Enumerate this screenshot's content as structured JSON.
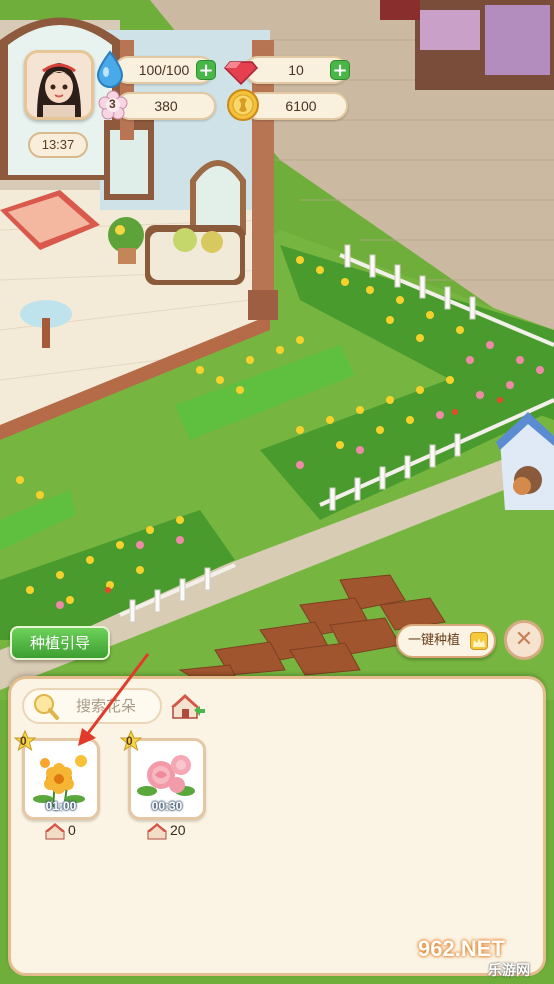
{
  "hud": {
    "time": "13:37",
    "water": "100/100",
    "gems": "10",
    "level": "3",
    "flowers": "380",
    "coins": "6100"
  },
  "buttons": {
    "guide": "种植引导",
    "plant_all": "一键种植"
  },
  "panel": {
    "search_placeholder": "搜索花朵",
    "seeds": [
      {
        "name": "marigold",
        "level": "0",
        "timer": "01:00",
        "cost": "0"
      },
      {
        "name": "rose",
        "level": "0",
        "timer": "00:30",
        "cost": "20"
      }
    ]
  },
  "watermark": {
    "brand": "962.NET",
    "sub": "乐游网"
  },
  "icons": [
    "water-drop-icon",
    "gem-icon",
    "flower-level-icon",
    "coin-icon",
    "plus-icon",
    "search-icon",
    "house-icon",
    "crown-icon",
    "close-icon",
    "star-icon"
  ],
  "colors": {
    "grass": "#6fae3b",
    "panel_bg": "#fbf3e3",
    "panel_border": "#e4bd8f",
    "accent_green": "#49b648"
  }
}
